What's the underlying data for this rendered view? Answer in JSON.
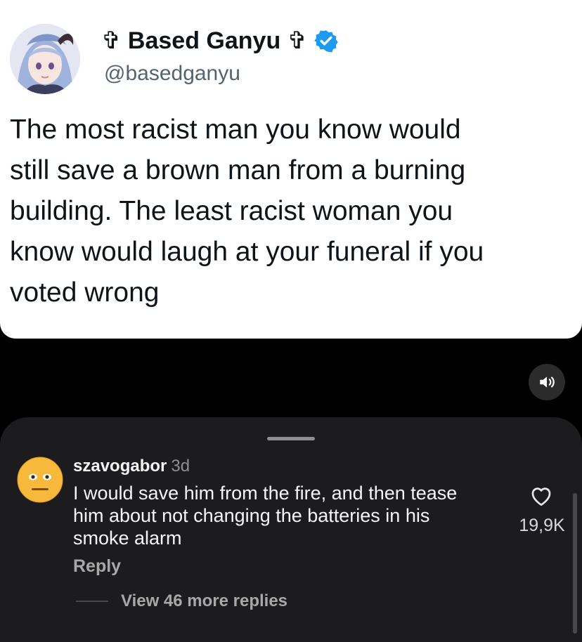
{
  "tweet": {
    "display_name": "✞ Based Ganyu ✞",
    "handle": "@basedganyu",
    "verified_icon": "verified-badge-icon",
    "text": "The most racist man you know would\nstill save a brown man from a burning\nbuilding. The least racist woman you\nknow would laugh at your funeral if you\nvoted wrong"
  },
  "media": {
    "sound_icon": "speaker-icon"
  },
  "comments": {
    "username": "szavogabor",
    "time": "3d",
    "text": "I would save him from the fire, and then tease\nhim about not changing the batteries in his\nsmoke alarm",
    "reply_label": "Reply",
    "like_count": "19,9K",
    "view_replies_label": "View 46 more replies"
  },
  "colors": {
    "verified_blue": "#1d9bf0",
    "sheet_background": "#1c1c1e"
  }
}
